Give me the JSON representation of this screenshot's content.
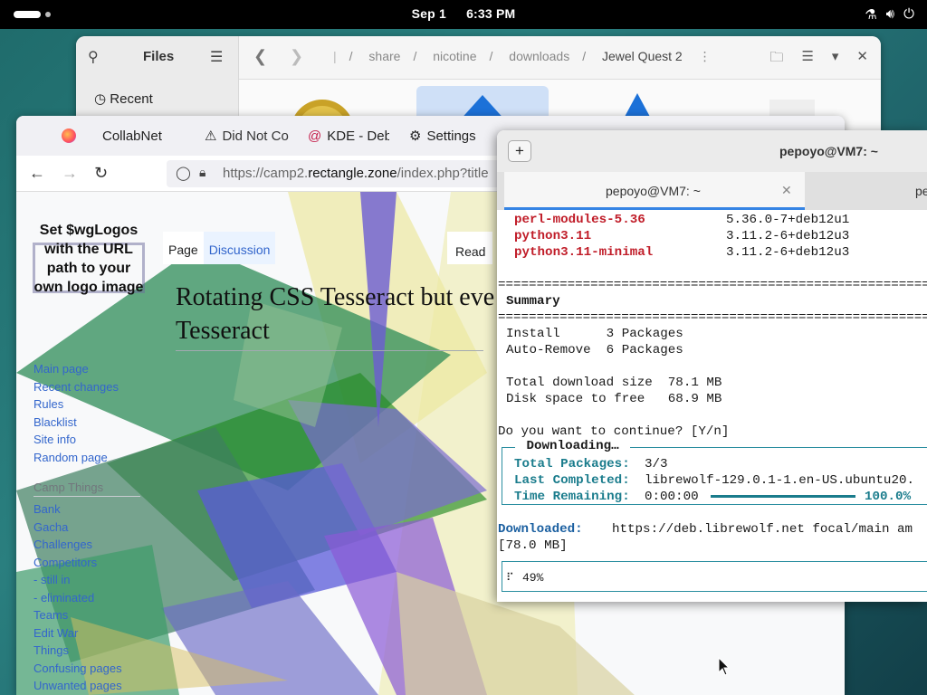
{
  "topbar": {
    "date": "Sep 1",
    "time": "6:33 PM"
  },
  "files": {
    "title": "Files",
    "sidebar_recent": "Recent",
    "breadcrumbs": [
      "share",
      "nicotine",
      "downloads",
      "Jewel Quest 2"
    ],
    "breadcrumb_sep": "/"
  },
  "browser": {
    "tabs": [
      {
        "label": "CollabNet"
      },
      {
        "label": "Did Not Co"
      },
      {
        "label": "KDE - Deb"
      },
      {
        "label": "Settings"
      }
    ],
    "url_prefix": "https://camp2.",
    "url_domain": "rectangle.zone",
    "url_suffix": "/index.php?title"
  },
  "wiki": {
    "logo_text": "Set $wgLogos with the URL path to your own logo image",
    "tab_page": "Page",
    "tab_discussion": "Discussion",
    "tab_read": "Read",
    "title_line1": "Rotating CSS Tesseract but eve",
    "title_line2": "Tesseract",
    "nav_main": [
      "Main page",
      "Recent changes",
      "Rules",
      "Blacklist",
      "Site info",
      "Random page"
    ],
    "nav_heading": "Camp Things",
    "nav_camp": [
      "Bank",
      "Gacha",
      "Challenges",
      "Competitors",
      "- still in",
      "- eliminated",
      "Teams",
      "Edit War",
      "Things",
      "Confusing pages",
      "Unwanted pages"
    ]
  },
  "terminal": {
    "window_title": "pepoyo@VM7: ~",
    "tab1": "pepoyo@VM7: ~",
    "tab2": "pe",
    "pkgs": [
      {
        "name": "perl-modules-5.36",
        "ver": "5.36.0-7+deb12u1"
      },
      {
        "name": "python3.11",
        "ver": "3.11.2-6+deb12u3"
      },
      {
        "name": "python3.11-minimal",
        "ver": "3.11.2-6+deb12u3"
      }
    ],
    "rule": "==================================================================",
    "summary": "Summary",
    "install": "Install      3 Packages",
    "autoremove": "Auto-Remove  6 Packages",
    "total_dl": "Total download size  78.1 MB",
    "disk_free": "Disk space to free   68.9 MB",
    "prompt": "Do you want to continue? [Y/n]",
    "dl_title": " Downloading… ",
    "total_pkgs_label": "Total Packages:",
    "total_pkgs_val": "3/3",
    "last_label": "Last Completed:",
    "last_val": "librewolf-129.0.1-1.en-US.ubuntu20.",
    "remain_label": "Time Remaining:",
    "remain_val": "0:00:00",
    "remain_pct": "100.0%",
    "downloaded_label": "Downloaded:",
    "downloaded_val": "https://deb.librewolf.net focal/main am",
    "downloaded_size": "[78.0 MB]",
    "spinner": "⠏",
    "progress": "49%"
  }
}
